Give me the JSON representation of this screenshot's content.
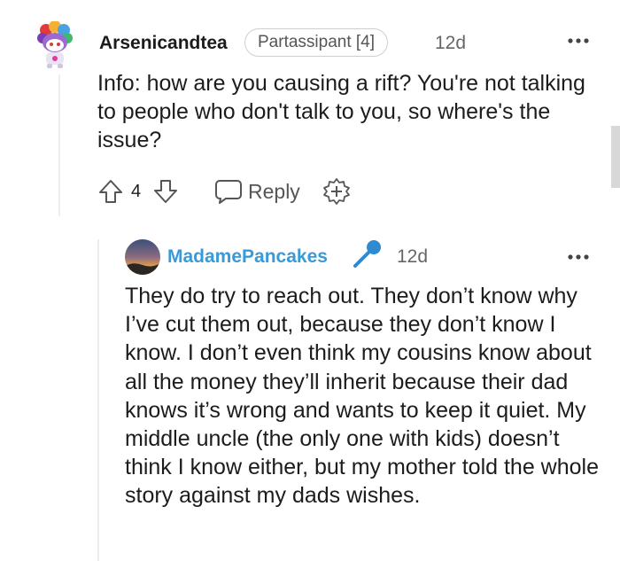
{
  "comment": {
    "username": "Arsenicandtea",
    "flair": "Partassipant [4]",
    "time": "12d",
    "text": "Info: how are you causing a rift? You're not talking to people who don't talk to you, so where's the issue?",
    "vote_count": "4",
    "reply_label": "Reply"
  },
  "reply": {
    "username": "MadamePancakes",
    "time": "12d",
    "text": "They do try to reach out. They don’t know why I’ve cut them out, because they don’t know I know. I don’t even think my cousins know about all the money they’ll inherit because their dad knows it’s wrong and wants to keep it quiet. My middle uncle (the only one with kids) doesn’t think I know either, but my mother told the whole story against my dads wishes."
  },
  "colors": {
    "reply_username": "#3a9ad9",
    "text": "#1c1c1c",
    "muted": "#666666"
  },
  "icons": [
    "avatar-snoo",
    "more-options-icon",
    "upvote-icon",
    "downvote-icon",
    "reply-icon",
    "award-icon",
    "microphone-icon",
    "avatar-sunset"
  ]
}
